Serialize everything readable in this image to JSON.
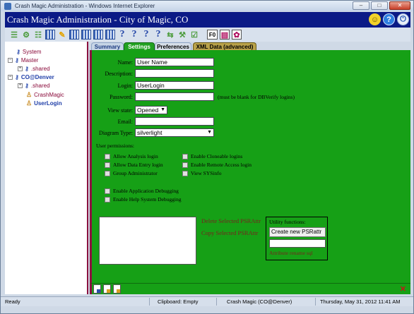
{
  "window": {
    "title": "Crash Magic Administration - Windows Internet Explorer",
    "buttons": [
      "–",
      "□",
      "✕"
    ]
  },
  "header": {
    "title": "Crash Magic Administration - City of Magic, CO",
    "icons": [
      "smile-icon",
      "help-icon",
      "power-icon"
    ]
  },
  "toolbar": {
    "f0_label": "F0"
  },
  "tree": {
    "items": [
      {
        "label": "System",
        "icon": "key-icon",
        "expander": ""
      },
      {
        "label": "Master",
        "icon": "key-icon",
        "expander": "−"
      },
      {
        "label": ".shared",
        "icon": "key-icon",
        "expander": "+"
      },
      {
        "label": "CO@Denver",
        "icon": "key-icon",
        "expander": "−"
      },
      {
        "label": ".shared",
        "icon": "key-icon",
        "expander": "+"
      },
      {
        "label": "CrashMagic",
        "icon": "person-icon",
        "expander": ""
      },
      {
        "label": "UserLogin",
        "icon": "person-icon",
        "expander": ""
      }
    ]
  },
  "tabs": {
    "summary": "Summary",
    "settings": "Settings",
    "preferences": "Preferences",
    "xml": "XML Data (advanced)"
  },
  "form": {
    "name_label": "Name:",
    "name_value": "User Name",
    "description_label": "Description:",
    "description_value": "",
    "login_label": "Login:",
    "login_value": "UserLogin",
    "password_label": "Password:",
    "password_value": "",
    "password_note": "(must be blank for DBVerify logins)",
    "view_state_label": "View state:",
    "view_state_value": "Opened",
    "email_label": "Email:",
    "email_value": "",
    "diagram_type_label": "Diagram Type:",
    "diagram_type_value": "silverlight"
  },
  "permissions": {
    "heading": "User permissions:",
    "items": [
      "Allow Analysis login",
      "Allow Data Entry login",
      "Group Administrator",
      "Enable Cloneable logins",
      "Enable Remote Access login",
      "View SYSinfo"
    ]
  },
  "debugging": {
    "items": [
      "Enable Application Debugging",
      "Enable Help System Debugging"
    ]
  },
  "psr": {
    "delete_label": "Delete Selected PSRAttr",
    "copy_label": "Copy Selected PSRAttr"
  },
  "utility": {
    "title": "Utility functions:",
    "create_button": "Create new PSRattr",
    "input_value": "",
    "link": "Attribute rename sql"
  },
  "status": {
    "ready": "Ready",
    "clipboard": "Clipboard: Empty",
    "session": "Crash Magic (CO@Denver)",
    "datetime": "Thursday, May 31, 2012 11:41 AM"
  }
}
